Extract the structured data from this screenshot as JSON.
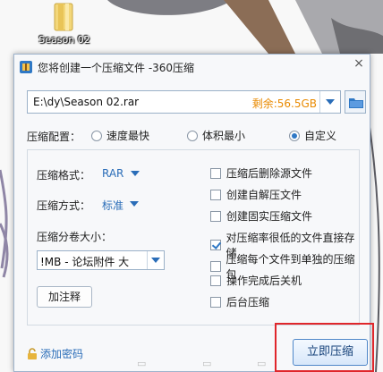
{
  "desktop": {
    "folder_label": "Season 02"
  },
  "dialog": {
    "title": "您将创建一个压缩文件 -360压缩",
    "close_symbol": "×",
    "path": {
      "value": "E:\\dy\\Season 02.rar",
      "free_space": "剩余:56.5GB"
    },
    "config": {
      "label": "压缩配置：",
      "options": [
        "速度最快",
        "体积最小",
        "自定义"
      ],
      "selected": "自定义"
    },
    "format": {
      "label": "压缩格式：",
      "value": "RAR"
    },
    "method": {
      "label": "压缩方式：",
      "value": "标准"
    },
    "split": {
      "label": "压缩分卷大小：",
      "value": "!MB    - 论坛附件 大"
    },
    "note_button": "加注释",
    "checkboxes": [
      {
        "label": "压缩后删除源文件",
        "checked": false
      },
      {
        "label": "创建自解压文件",
        "checked": false
      },
      {
        "label": "创建固实压缩文件",
        "checked": false
      },
      {
        "label": "对压缩率很低的文件直接存储",
        "checked": true
      },
      {
        "label": "压缩每个文件到单独的压缩包",
        "checked": false
      },
      {
        "label": "操作完成后关机",
        "checked": false
      },
      {
        "label": "后台压缩",
        "checked": false
      }
    ],
    "add_password": "添加密码",
    "compress_button": "立即压缩"
  },
  "colors": {
    "accent": "#2a6db8",
    "free_space": "#e98a00",
    "highlight_frame": "#e0262b"
  }
}
